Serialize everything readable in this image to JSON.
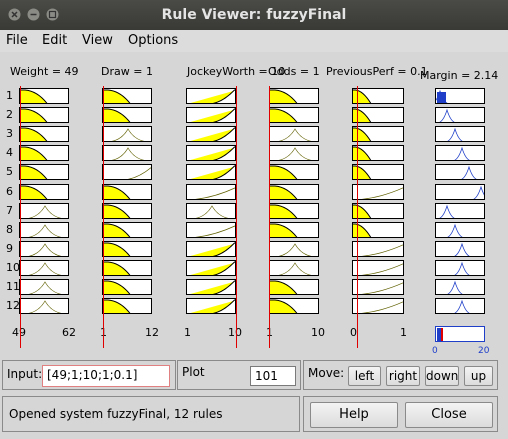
{
  "window": {
    "title": "Rule Viewer: fuzzyFinal"
  },
  "menubar": {
    "items": [
      "File",
      "Edit",
      "View",
      "Options"
    ]
  },
  "inputs": [
    {
      "label": "Weight = 49",
      "min": "49",
      "max": "62"
    },
    {
      "label": "Draw = 1",
      "min": "1",
      "max": "12"
    },
    {
      "label": "JockeyWorth = 10",
      "min": "1",
      "max": "10"
    },
    {
      "label": "Odds = 1",
      "min": "1",
      "max": "10"
    },
    {
      "label": "PreviousPerf = 0.1",
      "min": "0",
      "max": "1"
    }
  ],
  "output": {
    "label": "Margin = 2.14",
    "min": "0",
    "max": "20"
  },
  "rules": [
    "1",
    "2",
    "3",
    "4",
    "5",
    "6",
    "7",
    "8",
    "9",
    "10",
    "11",
    "12"
  ],
  "rule_shapes": {
    "Weight": [
      "zl",
      "zl",
      "zl",
      "zl",
      "zl",
      "zl",
      "mid",
      "mid",
      "mid",
      "mid",
      "mid",
      "mid"
    ],
    "Draw": [
      "zl",
      "zl",
      "mid",
      "mid",
      "sh",
      "zl",
      "zl",
      "zl",
      "zl",
      "zl",
      "zl",
      "zl"
    ],
    "JockeyWorth": [
      "sf",
      "sf",
      "sf",
      "sf",
      "sf",
      "sl",
      "mid",
      "sl",
      "sf",
      "sf",
      "sf",
      "sf"
    ],
    "Odds": [
      "zf",
      "zf",
      "mid",
      "mid",
      "zf",
      "zf",
      "zf",
      "zf",
      "mid",
      "mid",
      "zf",
      "zf"
    ],
    "PreviousPerf": [
      "zs",
      "zs",
      "zs",
      "zs",
      "zs",
      "sl",
      "zs",
      "zs",
      "sl",
      "sl",
      "sl",
      "sl"
    ],
    "Margin": [
      "o1",
      "o2",
      "o3",
      "o4",
      "o5",
      "o6",
      "o2",
      "o3",
      "o4",
      "o4",
      "o3",
      "o4"
    ]
  },
  "input_panel": {
    "label": "Input:",
    "value": "[49;1;10;1;0.1]"
  },
  "plot_panel": {
    "label": "Plot",
    "value": "101"
  },
  "move_panel": {
    "label": "Move:",
    "buttons": [
      "left",
      "right",
      "down",
      "up"
    ]
  },
  "status": {
    "text": "Opened system fuzzyFinal, 12 rules"
  },
  "actions": {
    "help": "Help",
    "close": "Close"
  },
  "colors": {
    "fill": "#ffff00",
    "output_fill": "#1f3fc9",
    "marker": "#e00000",
    "curve": "#606000"
  }
}
